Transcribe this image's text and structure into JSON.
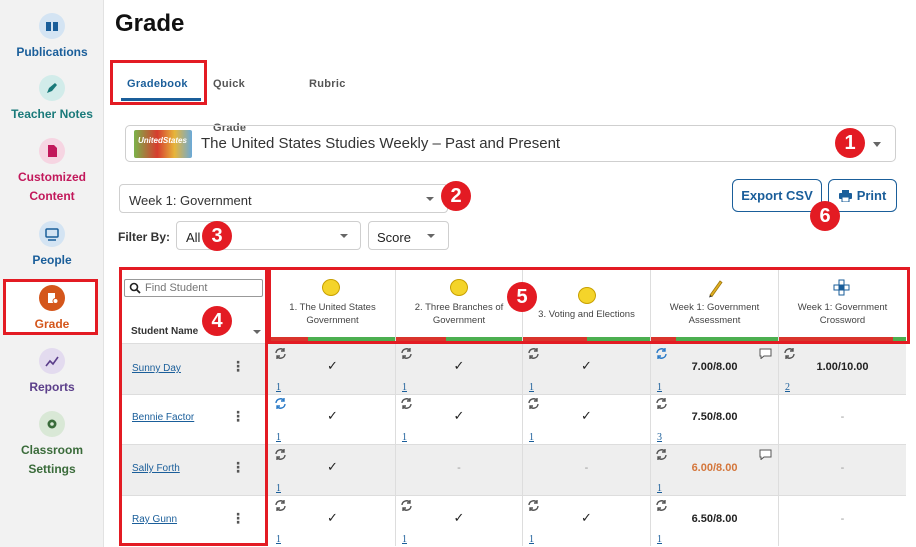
{
  "sidebar": {
    "items": [
      {
        "label": "Publications",
        "icon": "book-icon",
        "color": "#1a5e9a",
        "bg": "#d4e4f3"
      },
      {
        "label": "Teacher Notes",
        "icon": "pen-icon",
        "color": "#1a7a7a",
        "bg": "#d2ecea"
      },
      {
        "label": "Customized Content",
        "icon": "document-icon",
        "color": "#c2185b",
        "bg": "#f6d5e2"
      },
      {
        "label": "People",
        "icon": "people-icon",
        "color": "#1a5e9a",
        "bg": "#d4e4f3"
      },
      {
        "label": "Grade",
        "icon": "grade-icon",
        "color": "#d4561b",
        "bg": "#d4561b"
      },
      {
        "label": "Reports",
        "icon": "chart-icon",
        "color": "#5b3e8a",
        "bg": "#e3dbef"
      },
      {
        "label": "Classroom Settings",
        "icon": "gear-icon",
        "color": "#3a6b3a",
        "bg": "#d9e8d6"
      }
    ]
  },
  "page": {
    "title": "Grade"
  },
  "tabs": [
    {
      "label": "Gradebook"
    },
    {
      "label": "Quick Grade"
    },
    {
      "label": "Rubric"
    }
  ],
  "publication": {
    "thumb_text": "UnitedStates",
    "name": "The United States Studies Weekly – Past and Present"
  },
  "week": {
    "selected": "Week 1: Government"
  },
  "filter": {
    "label": "Filter By:",
    "status": "All",
    "type": "Score"
  },
  "buttons": {
    "export": "Export CSV",
    "print": "Print"
  },
  "badges": [
    "1",
    "2",
    "3",
    "4",
    "5",
    "6"
  ],
  "students_panel": {
    "search_placeholder": "Find Student",
    "header": "Student Name"
  },
  "assignments": [
    {
      "title": "1. The United States Government",
      "icon": "coin-icon",
      "bar": [
        30,
        70
      ]
    },
    {
      "title": "2. Three Branches of Government",
      "icon": "coin-icon",
      "bar": [
        40,
        60
      ]
    },
    {
      "title": "3. Voting and Elections",
      "icon": "coin-icon",
      "bar": [
        50,
        50
      ]
    },
    {
      "title": "Week 1: Government Assessment",
      "icon": "pencil-icon",
      "bar": [
        20,
        80
      ]
    },
    {
      "title": "Week 1: Government Crossword",
      "icon": "crossword-icon",
      "bar": [
        90,
        10
      ]
    }
  ],
  "rows": [
    {
      "name": "Sunny Day",
      "cells": [
        {
          "v": "✓",
          "link": "1"
        },
        {
          "v": "✓",
          "link": "1"
        },
        {
          "v": "✓",
          "link": "1"
        },
        {
          "v": "7.00/8.00",
          "link": "1",
          "comment": true,
          "blue": true
        },
        {
          "v": "1.00/10.00",
          "link": "2"
        }
      ]
    },
    {
      "name": "Bennie Factor",
      "cells": [
        {
          "v": "✓",
          "link": "1",
          "blue": true
        },
        {
          "v": "✓",
          "link": "1"
        },
        {
          "v": "✓",
          "link": "1"
        },
        {
          "v": "7.50/8.00",
          "link": "3"
        },
        {
          "v": "-",
          "empty": true
        }
      ]
    },
    {
      "name": "Sally Forth",
      "cells": [
        {
          "v": "✓",
          "link": "1"
        },
        {
          "v": "-",
          "empty": true
        },
        {
          "v": "-",
          "empty": true
        },
        {
          "v": "6.00/8.00",
          "link": "1",
          "comment": true,
          "orange": true
        },
        {
          "v": "-",
          "empty": true
        }
      ]
    },
    {
      "name": "Ray Gunn",
      "cells": [
        {
          "v": "✓",
          "link": "1"
        },
        {
          "v": "✓",
          "link": "1"
        },
        {
          "v": "✓",
          "link": "1"
        },
        {
          "v": "6.50/8.00",
          "link": "1"
        },
        {
          "v": "-",
          "empty": true
        }
      ]
    }
  ],
  "colors": {
    "accent": "#1a5e9a",
    "badge": "#e31b23",
    "late": "#d4763b",
    "bar_red": "#d9342b",
    "bar_green": "#4caf50"
  }
}
